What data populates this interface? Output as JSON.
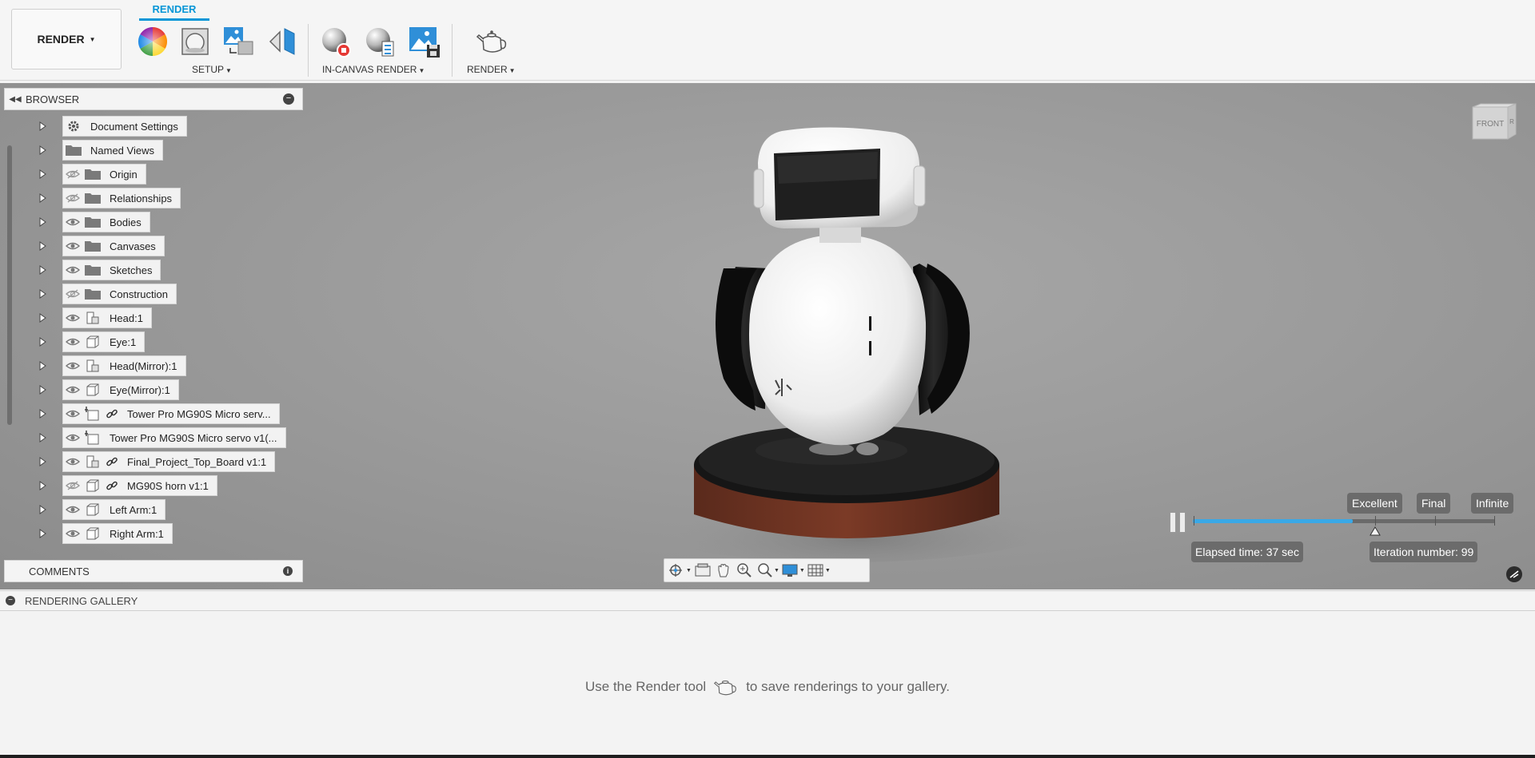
{
  "toolbar": {
    "workspace_label": "RENDER",
    "active_tab": "RENDER",
    "groups": {
      "setup": "SETUP",
      "in_canvas_render": "IN-CANVAS RENDER",
      "render": "RENDER"
    },
    "tools": [
      "appearance-icon",
      "scene-settings-icon",
      "texture-map-icon",
      "decal-icon",
      "in-canvas-render-icon",
      "in-canvas-render-settings-icon",
      "capture-image-icon",
      "render-teapot-icon"
    ]
  },
  "browser": {
    "title": "BROWSER",
    "items": [
      {
        "label": "Document Settings",
        "icon": "gear-icon",
        "visibility": "none",
        "link": false
      },
      {
        "label": "Named Views",
        "icon": "folder-icon",
        "visibility": "none",
        "link": false
      },
      {
        "label": "Origin",
        "icon": "folder-icon",
        "visibility": "hidden",
        "link": false
      },
      {
        "label": "Relationships",
        "icon": "folder-icon",
        "visibility": "hidden",
        "link": false
      },
      {
        "label": "Bodies",
        "icon": "folder-icon",
        "visibility": "visible",
        "link": false
      },
      {
        "label": "Canvases",
        "icon": "folder-icon",
        "visibility": "visible",
        "link": false
      },
      {
        "label": "Sketches",
        "icon": "folder-icon",
        "visibility": "visible",
        "link": false
      },
      {
        "label": "Construction",
        "icon": "folder-icon",
        "visibility": "hidden",
        "link": false
      },
      {
        "label": "Head:1",
        "icon": "component-icon",
        "visibility": "visible",
        "link": false
      },
      {
        "label": "Eye:1",
        "icon": "body-icon",
        "visibility": "visible",
        "link": false
      },
      {
        "label": "Head(Mirror):1",
        "icon": "component-icon",
        "visibility": "visible",
        "link": false
      },
      {
        "label": "Eye(Mirror):1",
        "icon": "body-icon",
        "visibility": "visible",
        "link": false
      },
      {
        "label": "Tower Pro MG90S Micro serv...",
        "icon": "joint-component-icon",
        "visibility": "visible",
        "link": true
      },
      {
        "label": "Tower Pro MG90S Micro servo v1(...",
        "icon": "joint-component-icon",
        "visibility": "visible",
        "link": false
      },
      {
        "label": "Final_Project_Top_Board v1:1",
        "icon": "component-icon",
        "visibility": "visible",
        "link": true
      },
      {
        "label": "MG90S horn v1:1",
        "icon": "body-icon",
        "visibility": "hidden",
        "link": true
      },
      {
        "label": "Left Arm:1",
        "icon": "body-icon",
        "visibility": "visible",
        "link": false
      },
      {
        "label": "Right Arm:1",
        "icon": "body-icon",
        "visibility": "visible",
        "link": false
      }
    ]
  },
  "comments": {
    "title": "COMMENTS"
  },
  "viewcube": {
    "face_label": "FRONT",
    "side_label": "R"
  },
  "render_progress": {
    "quality_levels": [
      "Excellent",
      "Final",
      "Infinite"
    ],
    "progress_fraction": 0.53,
    "elapsed": "Elapsed time: 37 sec",
    "iteration": "Iteration number: 99"
  },
  "navbar": {
    "tools": [
      "orbit-icon",
      "look-at-icon",
      "pan-icon",
      "zoom-icon",
      "fit-icon",
      "display-settings-icon",
      "grid-icon"
    ]
  },
  "gallery": {
    "title": "RENDERING GALLERY",
    "hint_before": "Use the Render tool",
    "hint_after": "to save renderings to your gallery."
  },
  "colors": {
    "accent": "#0696d7",
    "progress": "#3aa8e6",
    "pill": "#6b6b6b"
  }
}
